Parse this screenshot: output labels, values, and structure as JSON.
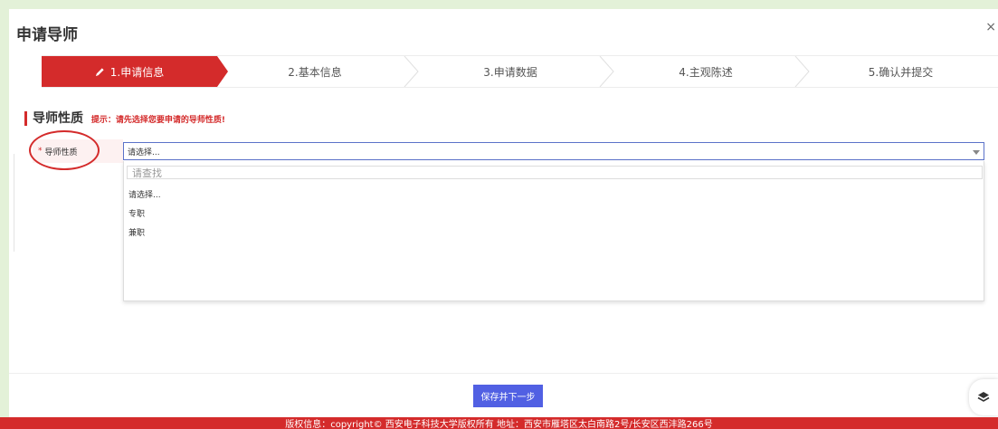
{
  "modal": {
    "title": "申请导师",
    "close_symbol": "×"
  },
  "steps": [
    {
      "label": "1.申请信息",
      "active": true,
      "icon": "pencil-icon"
    },
    {
      "label": "2.基本信息",
      "active": false
    },
    {
      "label": "3.申请数据",
      "active": false
    },
    {
      "label": "4.主观陈述",
      "active": false
    },
    {
      "label": "5.确认并提交",
      "active": false
    }
  ],
  "section": {
    "title": "导师性质",
    "tip": "提示：请先选择您要申请的导师性质!"
  },
  "field": {
    "required_mark": "*",
    "label": "导师性质",
    "selected_value": "请选择...",
    "search_placeholder": "请查找",
    "options": [
      "请选择...",
      "专职",
      "兼职"
    ]
  },
  "footer": {
    "save_label": "保存并下一步",
    "copyright": "版权信息：copyright© 西安电子科技大学版权所有 地址：西安市雁塔区太白南路2号/长安区西沣路266号"
  },
  "colors": {
    "accent_red": "#d42b2b",
    "primary_blue": "#5160e3",
    "page_background": "#e3f1d8"
  },
  "icons": {
    "float_button": "layers-icon",
    "select_arrow": "caret-down-icon"
  }
}
